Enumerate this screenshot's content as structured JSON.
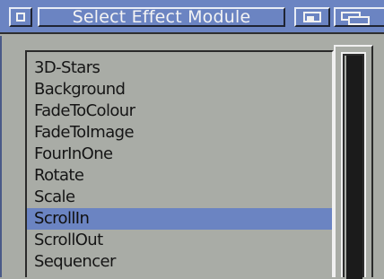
{
  "window": {
    "title": "Select Effect Module"
  },
  "list": {
    "items": [
      {
        "label": "3D-Stars"
      },
      {
        "label": "Background"
      },
      {
        "label": "FadeToColour"
      },
      {
        "label": "FadeToImage"
      },
      {
        "label": "FourInOne"
      },
      {
        "label": "Rotate"
      },
      {
        "label": "Scale"
      },
      {
        "label": "ScrollIn",
        "selected": true
      },
      {
        "label": "ScrollOut"
      },
      {
        "label": "Sequencer"
      }
    ]
  },
  "colors": {
    "titlebar": "#6b84c2",
    "background": "#a9aca6",
    "selection": "#6b84c2",
    "scrollbar": "#1b1b1b"
  },
  "icons": {
    "close": "close-gadget-icon",
    "zoom": "zoom-gadget-icon",
    "depth": "depth-gadget-icon"
  }
}
